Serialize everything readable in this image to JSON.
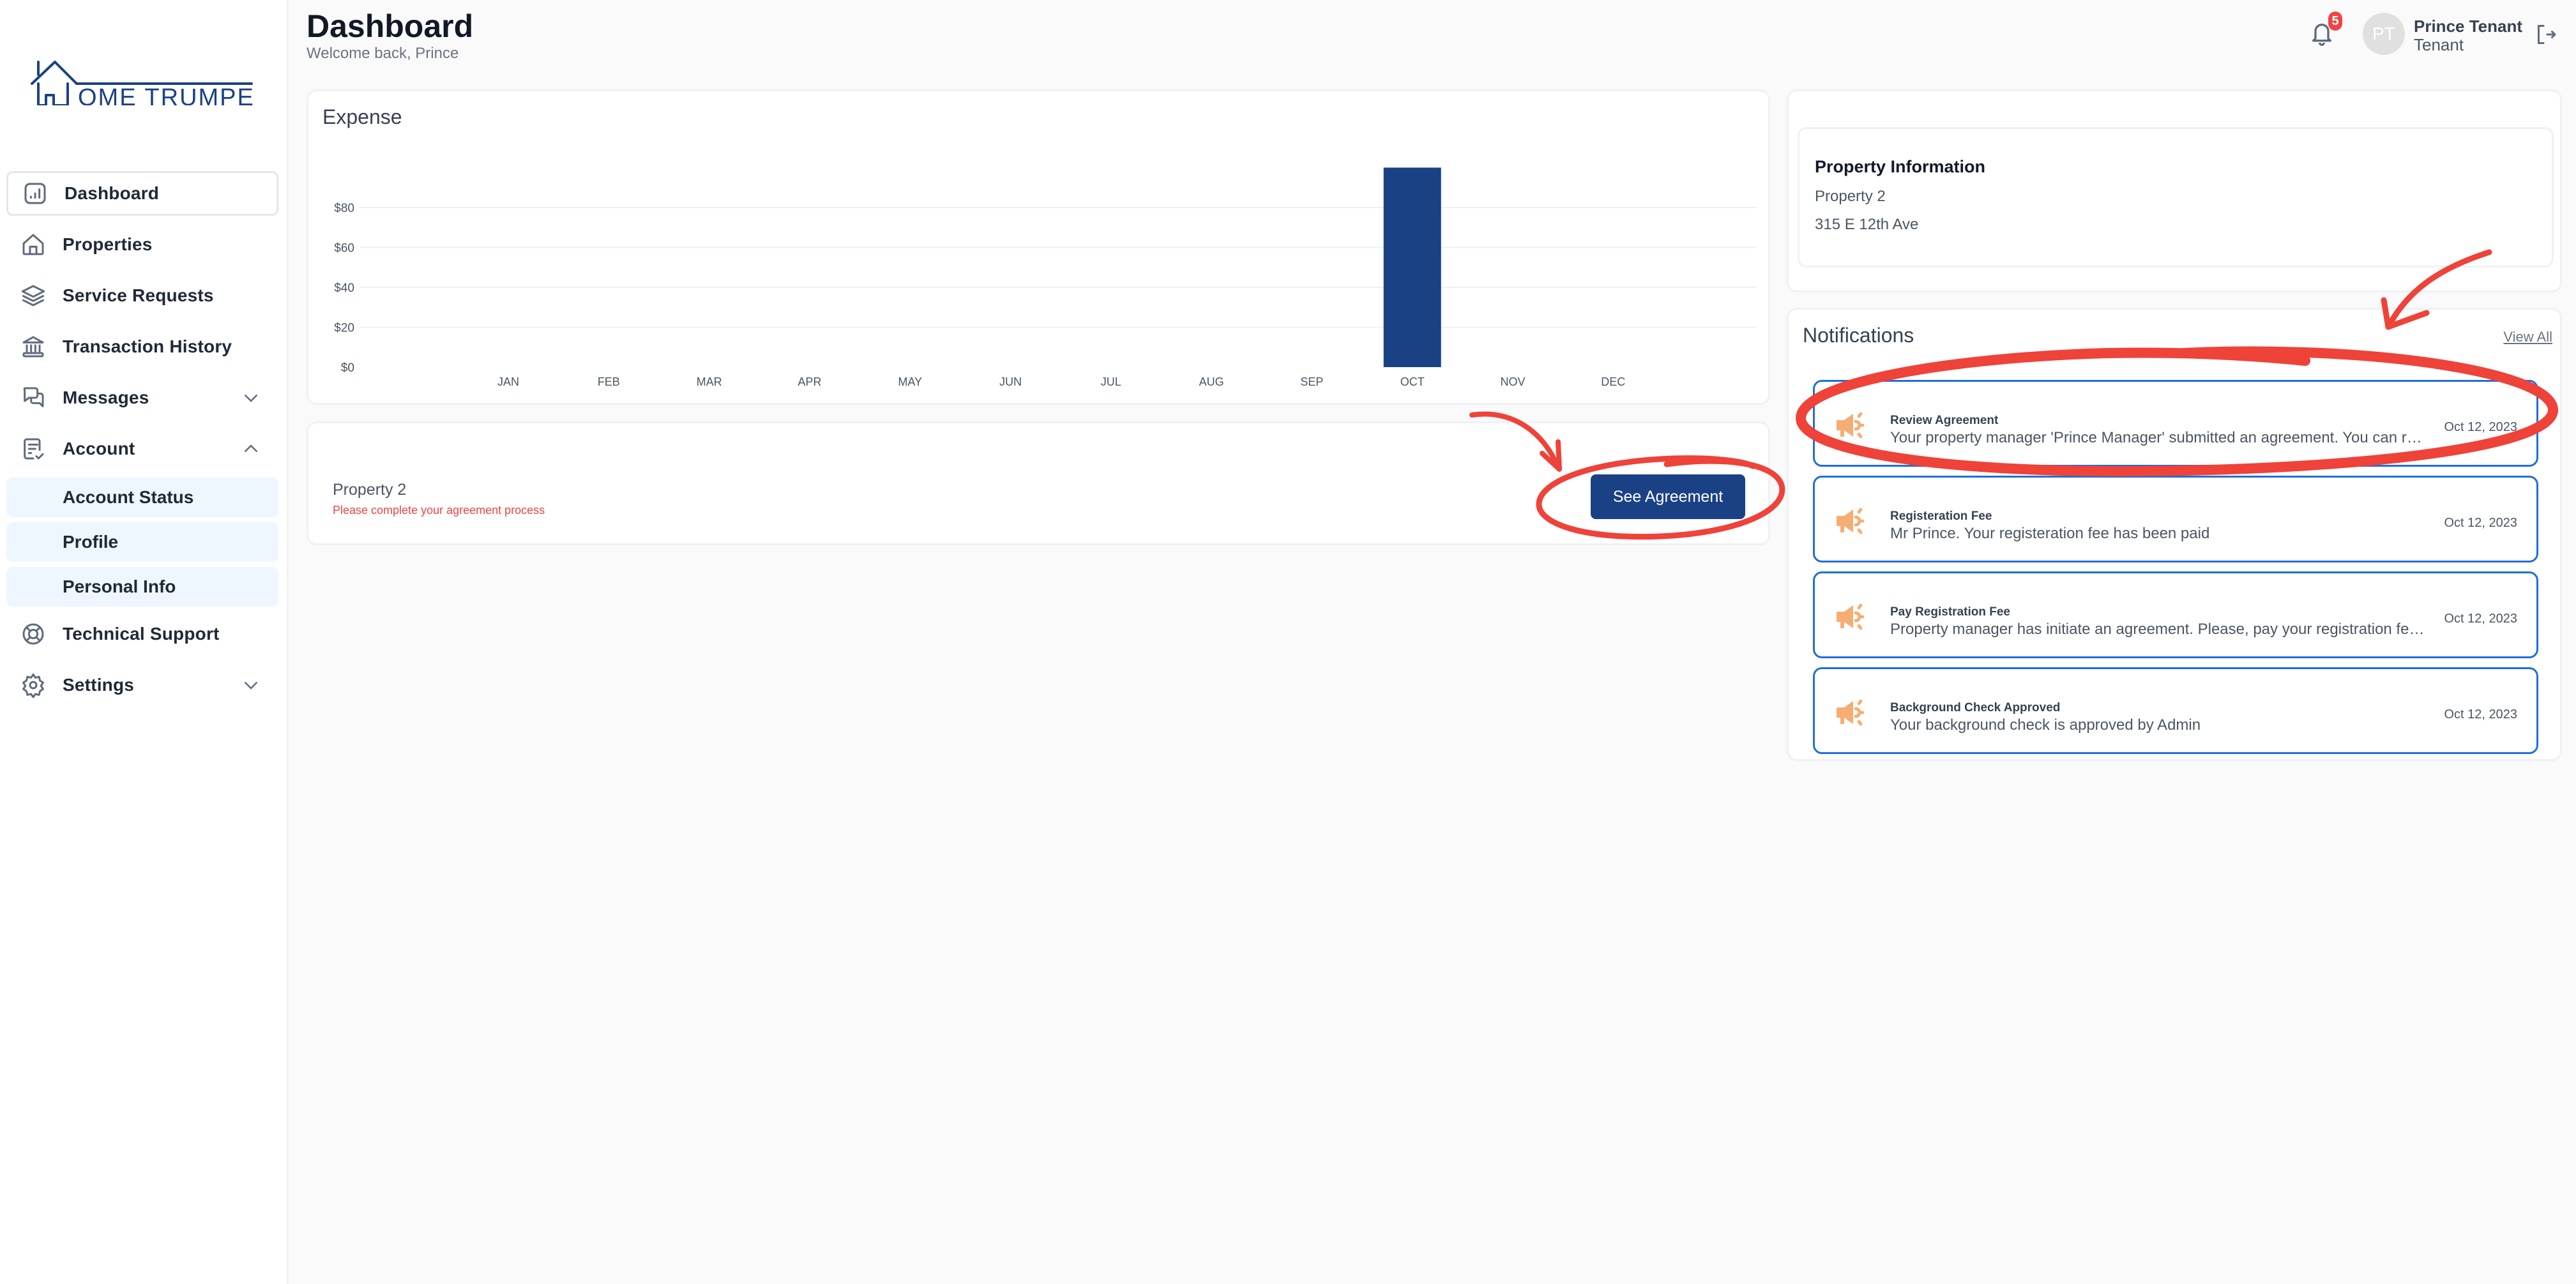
{
  "brand": {
    "logo_text": "OME TRUMPETER",
    "color": "#1b4185"
  },
  "sidebar": {
    "items": [
      {
        "label": "Dashboard",
        "icon": "chart-square-icon",
        "active": true
      },
      {
        "label": "Properties",
        "icon": "house-icon"
      },
      {
        "label": "Service Requests",
        "icon": "layers-icon"
      },
      {
        "label": "Transaction History",
        "icon": "bank-icon"
      },
      {
        "label": "Messages",
        "icon": "chat-bubbles-icon",
        "chevron": "down"
      },
      {
        "label": "Account",
        "icon": "document-check-icon",
        "chevron": "up"
      }
    ],
    "account_subitems": [
      {
        "label": "Account Status"
      },
      {
        "label": "Profile"
      },
      {
        "label": "Personal Info"
      }
    ],
    "bottom_items": [
      {
        "label": "Technical Support",
        "icon": "lifebuoy-icon"
      },
      {
        "label": "Settings",
        "icon": "gear-icon",
        "chevron": "down"
      }
    ]
  },
  "header": {
    "title": "Dashboard",
    "subtitle": "Welcome back, Prince",
    "notification_count": "5",
    "user": {
      "initials": "PT",
      "name": "Prince Tenant",
      "role": "Tenant"
    }
  },
  "expense": {
    "title": "Expense"
  },
  "chart_data": {
    "type": "bar",
    "title": "Expense",
    "categories": [
      "JAN",
      "FEB",
      "MAR",
      "APR",
      "MAY",
      "JUN",
      "JUL",
      "AUG",
      "SEP",
      "OCT",
      "NOV",
      "DEC"
    ],
    "values": [
      0,
      0,
      0,
      0,
      0,
      0,
      0,
      0,
      0,
      100,
      0,
      0
    ],
    "yticks": [
      0,
      20,
      40,
      60,
      80
    ],
    "ytick_labels": [
      "$0",
      "$20",
      "$40",
      "$60",
      "$80"
    ],
    "ylim": [
      0,
      100
    ],
    "xlabel": "",
    "ylabel": "",
    "grid": true,
    "bar_color": "#1a4183"
  },
  "agreement": {
    "property": "Property 2",
    "message": "Please complete your agreement process",
    "button_label": "See Agreement"
  },
  "property_info": {
    "title": "Property Information",
    "name": "Property 2",
    "address": "315 E 12th Ave"
  },
  "notifications": {
    "title": "Notifications",
    "view_all_label": "View All",
    "items": [
      {
        "title": "Review Agreement",
        "body": "Your property manager 'Prince Manager' submitted an agreement. You can review it and sign the agreement",
        "date": "Oct 12, 2023"
      },
      {
        "title": "Registeration Fee",
        "body": "Mr Prince. Your registeration fee has been paid",
        "date": "Oct 12, 2023"
      },
      {
        "title": "Pay Registration Fee",
        "body": "Property manager has initiate an agreement. Please, pay your registration fee to proceed",
        "date": "Oct 12, 2023"
      },
      {
        "title": "Background Check Approved",
        "body": "Your background check is approved by Admin",
        "date": "Oct 12, 2023"
      }
    ]
  },
  "colors": {
    "accent": "#1b4185",
    "alert": "#ef4444",
    "notif_border": "#1f6fd6",
    "megaphone": "#f6ad73",
    "annotation": "#ef4239"
  }
}
